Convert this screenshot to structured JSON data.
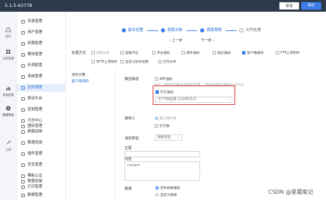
{
  "app": {
    "version": "5.1.5-63778"
  },
  "topbar": {
    "cancel_label": "取消",
    "save_label": "保存"
  },
  "rail": [
    {
      "label": "首页",
      "icon": "home-icon"
    },
    {
      "label": "运营管理",
      "icon": "grid-icon"
    },
    {
      "label": "系统配置",
      "icon": "chart-icon"
    },
    {
      "label": "管理系统",
      "icon": "gear-icon"
    },
    {
      "label": "工具",
      "icon": "tools-icon"
    }
  ],
  "menu": {
    "items": [
      {
        "label": "目录管理",
        "active": false
      },
      {
        "label": "用户管理",
        "active": false
      },
      {
        "label": "权限管理",
        "active": false
      },
      {
        "label": "模块管理",
        "active": false
      },
      {
        "label": "外观配置",
        "active": false
      },
      {
        "label": "系统管理",
        "active": false
      },
      {
        "label": "定时调度",
        "active": true
      },
      {
        "label": "移动平台",
        "active": false
      },
      {
        "label": "定制管理",
        "active": false
      },
      {
        "label": "日志中心",
        "active": false
      },
      {
        "label": "图标管理",
        "active": false
      },
      {
        "label": "数据运维",
        "active": false
      },
      {
        "label": "数据连接",
        "active": false
      },
      {
        "label": "插件管理",
        "active": false
      },
      {
        "label": "安全管理",
        "active": false
      },
      {
        "label": "模板认证",
        "active": false
      },
      {
        "label": "数据连接",
        "active": false
      },
      {
        "label": "打印管理",
        "active": false
      },
      {
        "label": "数据管理",
        "active": false
      }
    ]
  },
  "steps": [
    {
      "label": "基本设置",
      "done": true
    },
    {
      "label": "调度对象",
      "done": true
    },
    {
      "label": "调度周期",
      "done": true
    },
    {
      "label": "文件处理",
      "done": false
    }
  ],
  "nav": {
    "prev": "上一步",
    "next": "下一步"
  },
  "form": {
    "process_label": "处理方式",
    "options_row1": [
      {
        "label": "定时分派",
        "checked": false,
        "dim": true
      },
      {
        "label": "挂载平台",
        "checked": false,
        "dim": false
      },
      {
        "label": "平台通知",
        "checked": false,
        "dim": false
      },
      {
        "label": "邮件通知",
        "checked": false,
        "dim": false
      },
      {
        "label": "短信通知",
        "checked": false,
        "dim": false
      },
      {
        "label": "客户端通知",
        "checked": true,
        "dim": false
      },
      {
        "label": "FTP上传附件",
        "checked": false,
        "dim": false
      }
    ],
    "options_row2": [
      {
        "label": "SFTP上传附件",
        "checked": false
      },
      {
        "label": "自定义附件说明",
        "checked": false
      },
      {
        "label": "打印文件",
        "checked": false
      }
    ],
    "subpanel": [
      {
        "label": "定时计算",
        "active": false
      },
      {
        "label": "客户端通知",
        "active": true
      }
    ],
    "push_channel_label": "推送渠道",
    "app_notice": {
      "label": "APP通知",
      "checked": false
    },
    "app_hint": "提示：APP的定时推送消息需先配置，才能推送到相应数据中心的平台",
    "dingtalk": {
      "label": "钉钉通知",
      "checked": true
    },
    "dingtalk_agent": "钉7789应用-123482527",
    "receiver_label": "接收人",
    "receiver_options": [
      {
        "label": "默认用户组",
        "checked": true,
        "dim": true
      },
      {
        "label": "钉钉群",
        "checked": false,
        "dim": false
      }
    ],
    "msg_type_label": "消息类型",
    "msg_type_value": "链接消息",
    "subject_label": "主题",
    "subject_value": "",
    "content_label": "内容",
    "content_value": "content",
    "link_label": "链接",
    "link_options": [
      {
        "label": "定时结果链接",
        "on": true
      },
      {
        "label": "自定义链接",
        "on": false
      }
    ]
  },
  "watermark": "CSDN @星霜笔记"
}
